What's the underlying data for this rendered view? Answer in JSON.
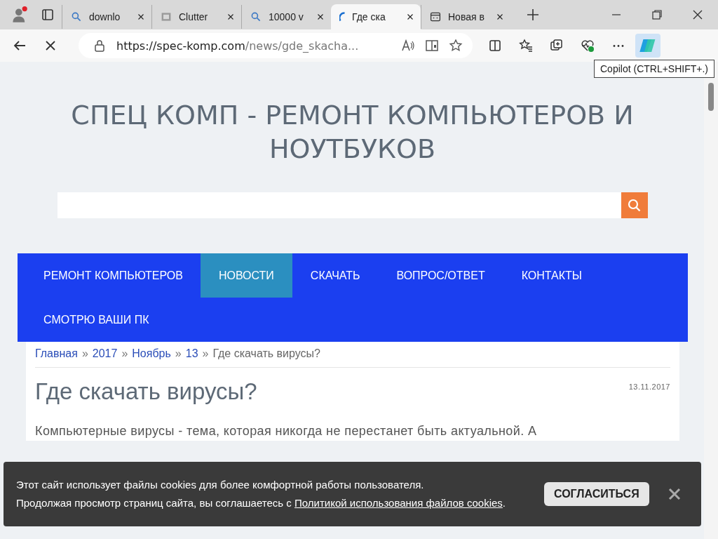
{
  "browser": {
    "tabs": [
      {
        "kind": "search",
        "title": "downlo",
        "selected": false
      },
      {
        "kind": "image",
        "title": "Clutter",
        "selected": false
      },
      {
        "kind": "search",
        "title": "10000 v",
        "selected": false
      },
      {
        "kind": "loading",
        "title": "Где ска",
        "selected": true
      },
      {
        "kind": "newtab",
        "title": "Новая в",
        "selected": false
      }
    ],
    "url_host": "https://spec-komp.com",
    "url_path": "/news/gde_skacha...",
    "tooltip": "Copilot (CTRL+SHIFT+.)"
  },
  "site": {
    "title": "СПЕЦ КОМП - РЕМОНТ КОМПЬЮТЕРОВ И НОУТБУКОВ",
    "nav": [
      {
        "label": "РЕМОНТ КОМПЬЮТЕРОВ",
        "selected": false
      },
      {
        "label": "НОВОСТИ",
        "selected": true
      },
      {
        "label": "СКАЧАТЬ",
        "selected": false
      },
      {
        "label": "ВОПРОС/ОТВЕТ",
        "selected": false
      },
      {
        "label": "КОНТАКТЫ",
        "selected": false
      },
      {
        "label": "СМОТРЮ ВАШИ ПК",
        "selected": false
      }
    ],
    "breadcrumbs": [
      {
        "label": "Главная",
        "kind": "link"
      },
      {
        "label": "»",
        "kind": "separator"
      },
      {
        "label": "2017",
        "kind": "link"
      },
      {
        "label": "»",
        "kind": "separator"
      },
      {
        "label": "Ноябрь",
        "kind": "link"
      },
      {
        "label": "»",
        "kind": "separator"
      },
      {
        "label": "13",
        "kind": "link"
      },
      {
        "label": "»",
        "kind": "separator"
      },
      {
        "label": "Где скачать вирусы?",
        "kind": "current"
      }
    ],
    "date": "13.11.2017",
    "heading": "Где скачать вирусы?",
    "paragraphs": [
      "Компьютерные вирусы - тема, которая никогда не перестанет быть актуальной. А"
    ]
  },
  "cookie_banner": {
    "line1": "Этот сайт использует файлы cookies для более комфортной работы пользователя.",
    "line2": "Продолжая просмотр страниц сайта, вы соглашаетесь с",
    "link": "Политикой использования файлов cookies",
    "end": ".",
    "button": "СОГЛАСИТЬСЯ"
  }
}
